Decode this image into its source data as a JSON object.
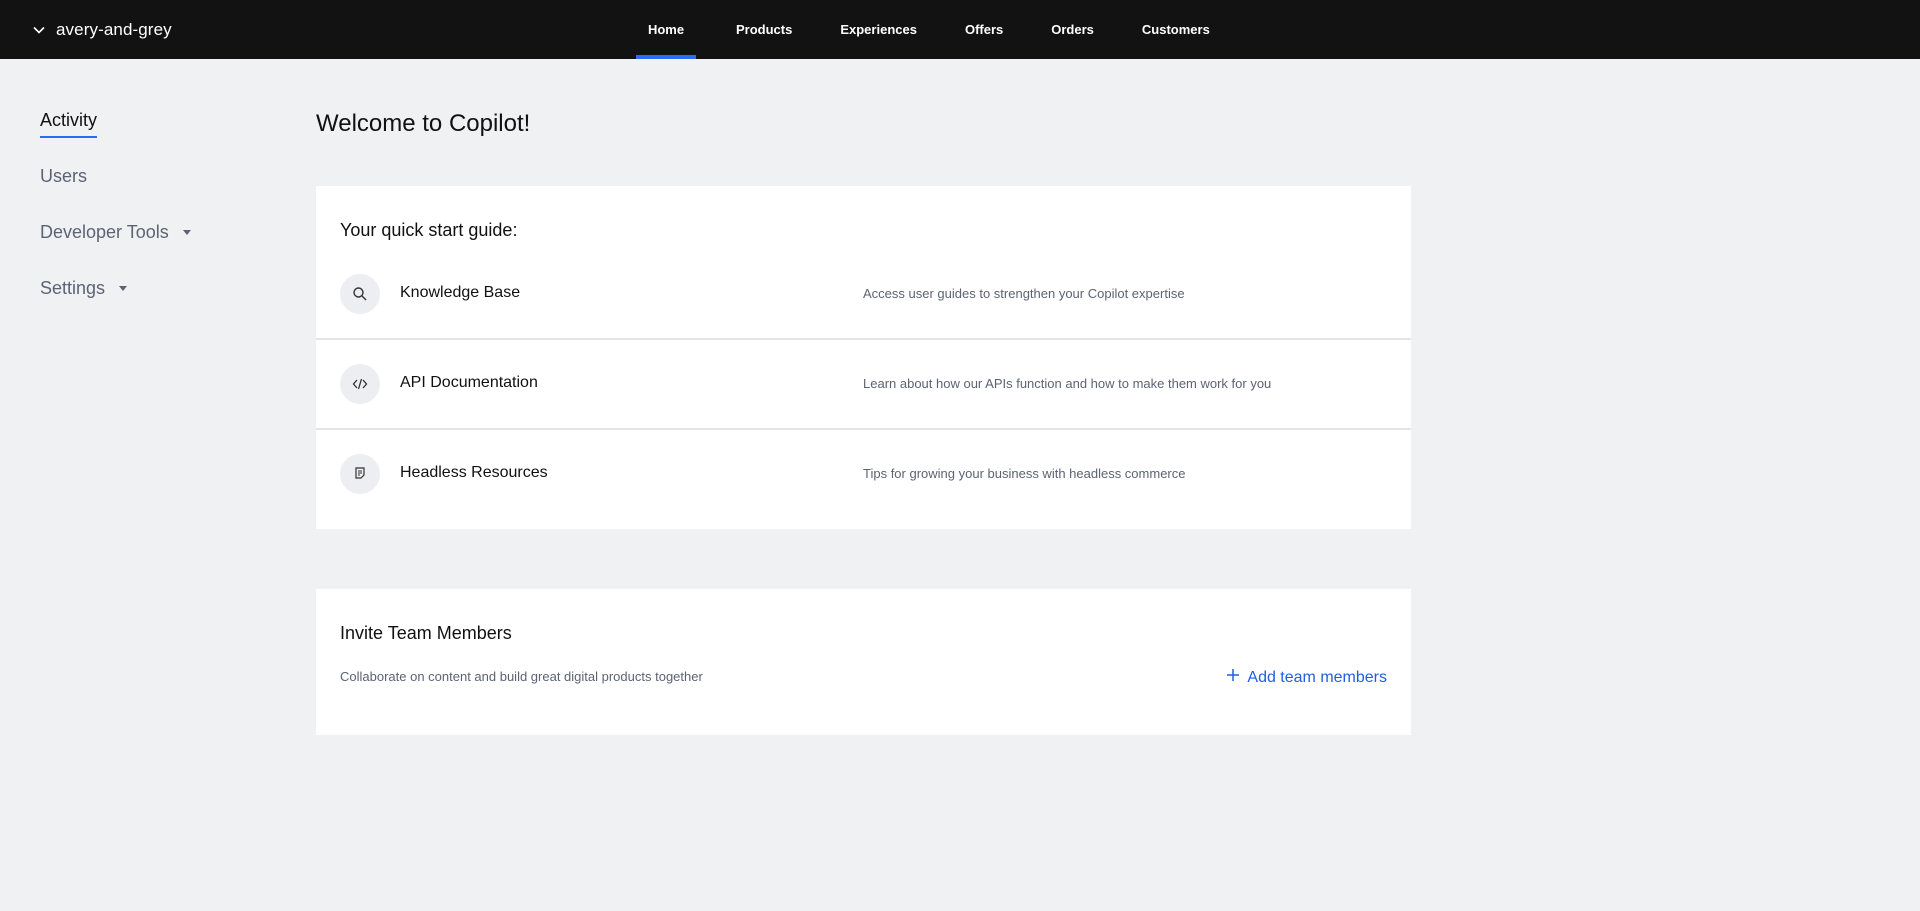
{
  "topbar": {
    "org_name": "avery-and-grey",
    "org_icon": "chevron-down-icon",
    "nav": [
      {
        "label": "Home",
        "active": true
      },
      {
        "label": "Products",
        "active": false
      },
      {
        "label": "Experiences",
        "active": false
      },
      {
        "label": "Offers",
        "active": false
      },
      {
        "label": "Orders",
        "active": false
      },
      {
        "label": "Customers",
        "active": false
      }
    ]
  },
  "sidebar": {
    "items": [
      {
        "label": "Activity",
        "active": true
      },
      {
        "label": "Users",
        "active": false
      },
      {
        "label": "Developer Tools",
        "active": false,
        "has_caret": true
      },
      {
        "label": "Settings",
        "active": false,
        "has_caret": true
      }
    ]
  },
  "main": {
    "title": "Welcome to Copilot!",
    "quick_start": {
      "heading": "Your quick start guide:",
      "items": [
        {
          "icon": "search-icon",
          "title": "Knowledge Base",
          "description": "Access user guides to strengthen your Copilot expertise"
        },
        {
          "icon": "code-icon",
          "title": "API Documentation",
          "description": "Learn about how our APIs function and how to make them work for you"
        },
        {
          "icon": "document-icon",
          "title": "Headless Resources",
          "description": "Tips for growing your business with headless commerce"
        }
      ]
    },
    "invite": {
      "heading": "Invite Team Members",
      "description": "Collaborate on content and build great digital products together",
      "action_label": "Add team members",
      "action_icon": "plus-icon"
    }
  },
  "colors": {
    "topbar_bg": "#121212",
    "page_bg": "#f0f1f3",
    "accent": "#2b6cf5",
    "link": "#1f5fe0",
    "muted_text": "#5c6373"
  }
}
